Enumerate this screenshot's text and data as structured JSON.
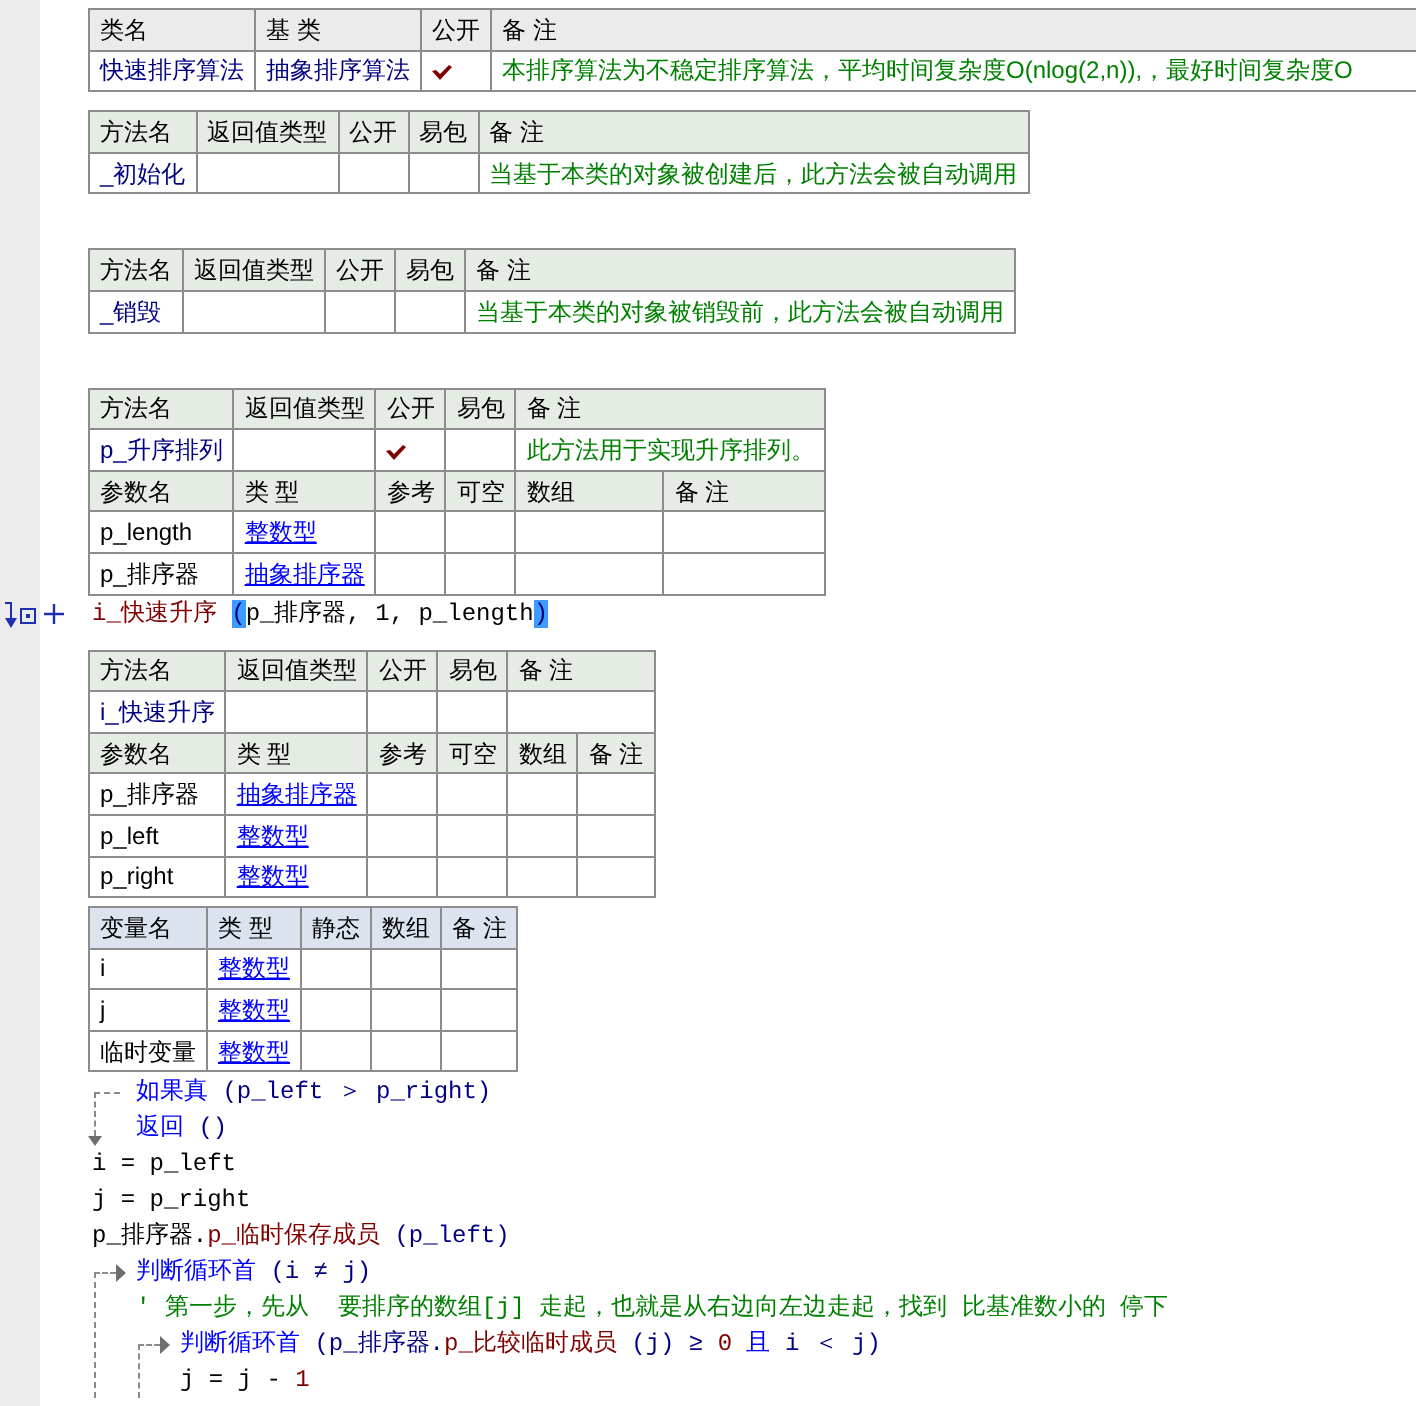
{
  "class_table": {
    "columns": [
      "类名",
      "基 类",
      "公开",
      "备 注"
    ],
    "name": "快速排序算法",
    "base": "抽象排序算法",
    "public": true,
    "remark": "本排序算法为不稳定排序算法，平均时间复杂度O(nlog(2,n)),，最好时间复杂度O"
  },
  "methods": [
    {
      "columns": [
        "方法名",
        "返回值类型",
        "公开",
        "易包",
        "备 注"
      ],
      "name": "_初始化",
      "public": false,
      "remark": "当基于本类的对象被创建后，此方法会被自动调用"
    },
    {
      "columns": [
        "方法名",
        "返回值类型",
        "公开",
        "易包",
        "备 注"
      ],
      "name": "_销毁",
      "public": false,
      "remark": "当基于本类的对象被销毁前，此方法会被自动调用"
    },
    {
      "columns": [
        "方法名",
        "返回值类型",
        "公开",
        "易包",
        "备 注"
      ],
      "name": "p_升序排列",
      "public": true,
      "remark": "此方法用于实现升序排列。",
      "param_columns": [
        "参数名",
        "类 型",
        "参考",
        "可空",
        "数组",
        "备 注"
      ],
      "params": [
        {
          "name": "p_length",
          "type": "整数型"
        },
        {
          "name": "p_排序器",
          "type": "抽象排序器"
        }
      ],
      "body": [
        {
          "kind": "statement",
          "marked": true,
          "tokens": [
            {
              "kind": "call",
              "text": "i_快速升序 ",
              "highlighted": false
            },
            {
              "kind": "paren",
              "text": "(",
              "highlighted": true
            },
            {
              "kind": "plain",
              "text": "p_排序器, 1, p_length",
              "highlighted": false
            },
            {
              "kind": "paren",
              "text": ")",
              "highlighted": true
            }
          ]
        }
      ]
    },
    {
      "columns": [
        "方法名",
        "返回值类型",
        "公开",
        "易包",
        "备 注"
      ],
      "name": "i_快速升序",
      "public": false,
      "param_columns": [
        "参数名",
        "类 型",
        "参考",
        "可空",
        "数组",
        "备 注"
      ],
      "params": [
        {
          "name": "p_排序器",
          "type": "抽象排序器"
        },
        {
          "name": "p_left",
          "type": "整数型"
        },
        {
          "name": "p_right",
          "type": "整数型"
        }
      ],
      "local_columns": [
        "变量名",
        "类 型",
        "静态",
        "数组",
        "备 注"
      ],
      "locals": [
        {
          "name": "i",
          "type": "整数型"
        },
        {
          "name": "j",
          "type": "整数型"
        },
        {
          "name": "临时变量",
          "type": "整数型"
        }
      ],
      "body": [
        {
          "kind": "if",
          "tokens": [
            {
              "kind": "keyword",
              "text": "如果真"
            },
            {
              "kind": "punct",
              "text": " (p_left ＞ p_right)"
            }
          ],
          "children": [
            {
              "kind": "statement",
              "tokens": [
                {
                  "kind": "keyword",
                  "text": "返回"
                },
                {
                  "kind": "punct",
                  "text": " ()"
                }
              ]
            }
          ]
        },
        {
          "kind": "statement",
          "tokens": [
            {
              "kind": "plain",
              "text": "i = p_left"
            }
          ]
        },
        {
          "kind": "statement",
          "tokens": [
            {
              "kind": "plain",
              "text": "j = p_right"
            }
          ]
        },
        {
          "kind": "statement",
          "tokens": [
            {
              "kind": "plain",
              "text": "p_排序器."
            },
            {
              "kind": "call",
              "text": "p_临时保存成员"
            },
            {
              "kind": "punct",
              "text": " (p_left)"
            }
          ]
        },
        {
          "kind": "loop",
          "tokens": [
            {
              "kind": "keyword",
              "text": "判断循环首"
            },
            {
              "kind": "punct",
              "text": " (i ≠ j)"
            }
          ],
          "children": [
            {
              "kind": "comment",
              "text": "' 第一步，先从  要排序的数组[j] 走起，也就是从右边向左边走起，找到 比基准数小的 停下"
            },
            {
              "kind": "loop",
              "tokens": [
                {
                  "kind": "keyword",
                  "text": "判断循环首"
                },
                {
                  "kind": "punct",
                  "text": " (p_排序器."
                },
                {
                  "kind": "call",
                  "text": "p_比较临时成员"
                },
                {
                  "kind": "punct",
                  "text": " (j) ≥ "
                },
                {
                  "kind": "number",
                  "text": "0"
                },
                {
                  "kind": "keyword",
                  "text": " 且"
                },
                {
                  "kind": "punct",
                  "text": " i ＜ j)"
                }
              ],
              "children": [
                {
                  "kind": "statement",
                  "tokens": [
                    {
                      "kind": "plain",
                      "text": "j = j - "
                    },
                    {
                      "kind": "number",
                      "text": "1"
                    }
                  ]
                }
              ]
            }
          ]
        }
      ]
    }
  ]
}
